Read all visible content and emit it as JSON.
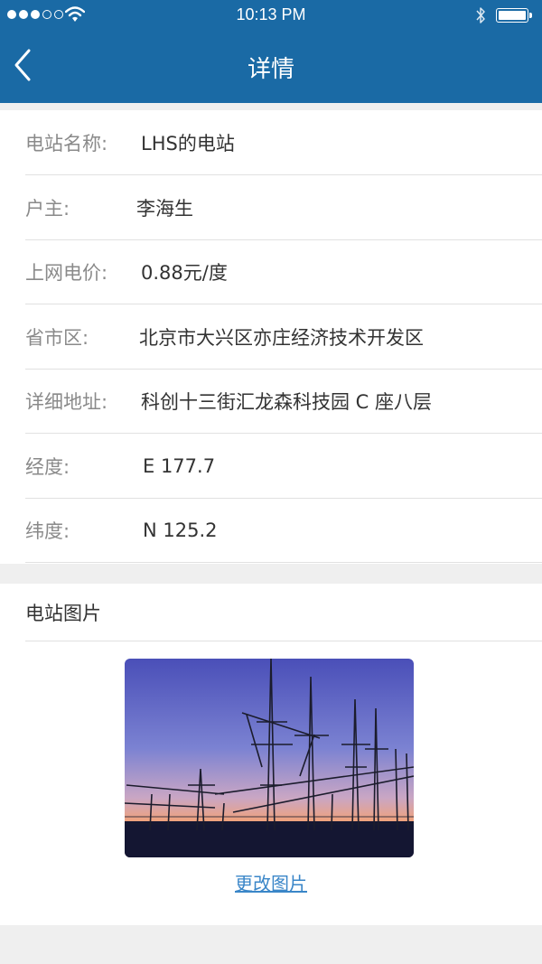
{
  "status_bar": {
    "time": "10:13 PM",
    "signal_icon": "signal-dots-icon",
    "wifi_icon": "wifi-icon",
    "bluetooth_icon": "bluetooth-icon",
    "battery_icon": "battery-icon"
  },
  "nav": {
    "title": "详情",
    "back_icon": "chevron-left-icon"
  },
  "details": [
    {
      "label": "电站名称:",
      "value": "LHS的电站"
    },
    {
      "label": "户主:",
      "value": "李海生"
    },
    {
      "label": "上网电价:",
      "value": "0.88元/度"
    },
    {
      "label": "省市区:",
      "value": "北京市大兴区亦庄经济技术开发区"
    },
    {
      "label": "详细地址:",
      "value": "科创十三街汇龙森科技园 C 座八层"
    },
    {
      "label": "经度:",
      "value": "E 177.7"
    },
    {
      "label": "纬度:",
      "value": "N 125.2"
    }
  ],
  "photo_section": {
    "heading": "电站图片",
    "change_link": "更改图片",
    "photo_subject": "power-station-transmission-towers-at-sunset"
  },
  "colors": {
    "header_bg": "#1a6aa5",
    "page_bg": "#efefef",
    "link": "#3a86c8"
  }
}
